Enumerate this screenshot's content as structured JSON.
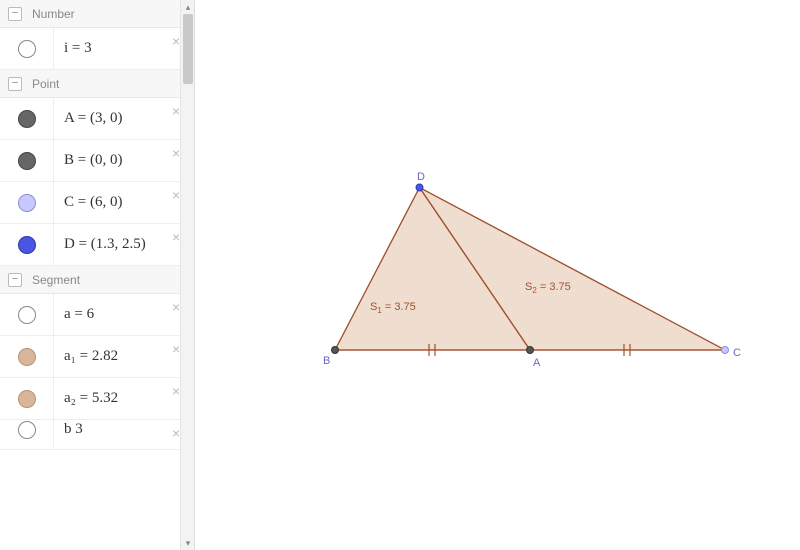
{
  "sidebar": {
    "groups": [
      {
        "title": "Number",
        "items": [
          {
            "label": "i = 3",
            "swatch": "hollow"
          }
        ]
      },
      {
        "title": "Point",
        "items": [
          {
            "label": "A = (3, 0)",
            "swatch": "dark"
          },
          {
            "label": "B = (0, 0)",
            "swatch": "dark"
          },
          {
            "label": "C = (6, 0)",
            "swatch": "lblue"
          },
          {
            "label": "D = (1.3, 2.5)",
            "swatch": "blue"
          }
        ]
      },
      {
        "title": "Segment",
        "items": [
          {
            "label": "a = 6",
            "swatch": "hollow"
          },
          {
            "label": "a₁ = 2.82",
            "swatch": "tan"
          },
          {
            "label": "a₂ = 5.32",
            "swatch": "tan"
          }
        ]
      }
    ],
    "partial_item": {
      "label": "b    3",
      "swatch": "hollow"
    }
  },
  "diagram": {
    "points": {
      "A": {
        "x": 3,
        "y": 0,
        "label": "A"
      },
      "B": {
        "x": 0,
        "y": 0,
        "label": "B"
      },
      "C": {
        "x": 6,
        "y": 0,
        "label": "C"
      },
      "D": {
        "x": 1.3,
        "y": 2.5,
        "label": "D"
      }
    },
    "areas": {
      "S1": {
        "value": 3.75,
        "label_prefix": "S",
        "label_sub": "1"
      },
      "S2": {
        "value": 3.75,
        "label_prefix": "S",
        "label_sub": "2"
      }
    }
  },
  "chart_data": {
    "type": "table",
    "title": "Geometry objects",
    "numbers": {
      "i": 3
    },
    "points": {
      "A": [
        3,
        0
      ],
      "B": [
        0,
        0
      ],
      "C": [
        6,
        0
      ],
      "D": [
        1.3,
        2.5
      ]
    },
    "segments": {
      "a": 6,
      "a1": 2.82,
      "a2": 5.32
    },
    "triangles": [
      {
        "name": "S1",
        "vertices": [
          "B",
          "A",
          "D"
        ],
        "area": 3.75
      },
      {
        "name": "S2",
        "vertices": [
          "A",
          "C",
          "D"
        ],
        "area": 3.75
      }
    ],
    "note": "A is midpoint of BC; BA and AC marked congruent"
  }
}
